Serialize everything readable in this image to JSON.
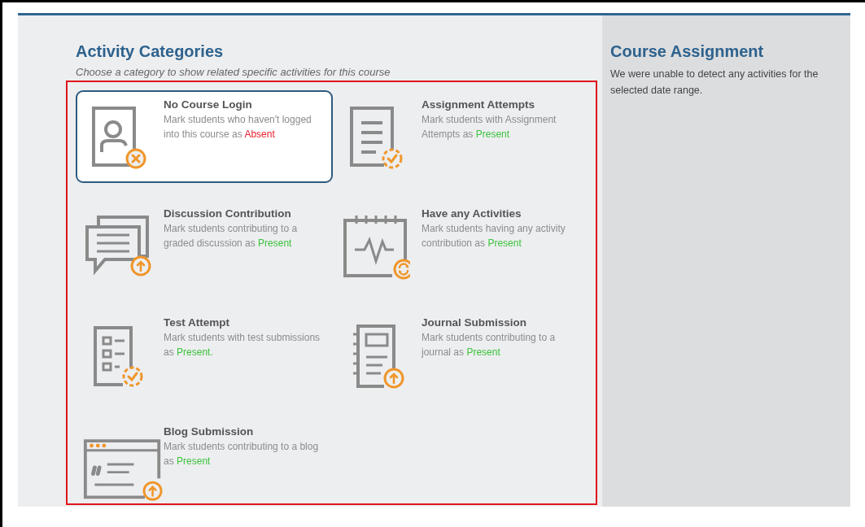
{
  "main": {
    "title": "Activity Categories",
    "subtitle": "Choose a category to show related specific activities for this course",
    "categories": [
      {
        "kind": "login",
        "title": "No Course Login",
        "description": "Mark students who haven't logged into this course as",
        "status": "Absent",
        "color": "#e8212c",
        "selected": true
      },
      {
        "kind": "assignment",
        "title": "Assignment Attempts",
        "description": "Mark students with Assignment Attempts as",
        "status": "Present",
        "color": "#3cc23c",
        "selected": false
      },
      {
        "kind": "discussion",
        "title": "Discussion Contribution",
        "description": "Mark students contributing to a graded discussion as",
        "status": "Present",
        "color": "#3cc23c",
        "selected": false
      },
      {
        "kind": "activity",
        "title": "Have any Activities",
        "description": "Mark students having any activity contribution as",
        "status": "Present",
        "color": "#3cc23c",
        "selected": false
      },
      {
        "kind": "test",
        "title": "Test Attempt",
        "description": "Mark students with test submissions as",
        "status": "Present.",
        "color": "#3cc23c",
        "selected": false
      },
      {
        "kind": "journal",
        "title": "Journal Submission",
        "description": "Mark students contributing to a journal as",
        "status": "Present",
        "color": "#3cc23c",
        "selected": false
      },
      {
        "kind": "blog",
        "title": "Blog Submission",
        "description": "Mark students contributing to a blog as",
        "status": "Present",
        "color": "#3cc23c",
        "selected": false
      }
    ]
  },
  "side": {
    "title": "Course Assignment",
    "message": "We were unable to detect any activities for the selected date range."
  }
}
